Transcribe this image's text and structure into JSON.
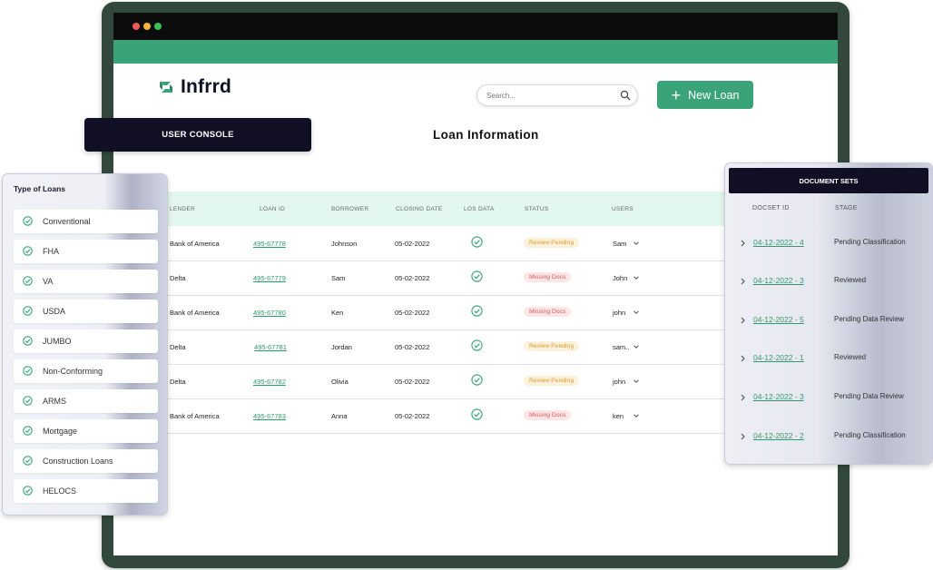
{
  "brand": {
    "name": "Infrrd",
    "accent": "#3aa378",
    "dark": "#100f23"
  },
  "search": {
    "placeholder": "Search..."
  },
  "new_loan_button": {
    "label": "New Loan"
  },
  "user_console": {
    "label": "USER CONSOLE"
  },
  "page_title": "Loan Information",
  "loan_table": {
    "columns": [
      "LENDER",
      "LOAN ID",
      "BORROWER",
      "CLOSING DATE",
      "LOS DATA",
      "STATUS",
      "USERS"
    ],
    "rows": [
      {
        "lender": "Bank of America",
        "loan_id": "495-67778",
        "borrower": "Johnson",
        "closing_date": "05-02-2022",
        "status": "Review Pending",
        "status_kind": "pending",
        "user": "Sam"
      },
      {
        "lender": "Delta",
        "loan_id": "495-67779",
        "borrower": "Sam",
        "closing_date": "05-02-2022",
        "status": "Missing Docs",
        "status_kind": "missing",
        "user": "John"
      },
      {
        "lender": "Bank of America",
        "loan_id": "495-67780",
        "borrower": "Ken",
        "closing_date": "05-02-2022",
        "status": "Missing Docs",
        "status_kind": "missing",
        "user": "john"
      },
      {
        "lender": "Delta",
        "loan_id": "495-67781",
        "borrower": "Jordan",
        "closing_date": "05-02-2022",
        "status": "Review Pending",
        "status_kind": "pending",
        "user": "sam.."
      },
      {
        "lender": "Delta",
        "loan_id": "495-67782",
        "borrower": "Olivia",
        "closing_date": "05-02-2022",
        "status": "Review Pending",
        "status_kind": "pending",
        "user": "john"
      },
      {
        "lender": "Bank of America",
        "loan_id": "495-67783",
        "borrower": "Anna",
        "closing_date": "05-02-2022",
        "status": "Missing Docs",
        "status_kind": "missing",
        "user": "ken"
      }
    ]
  },
  "loan_types": {
    "title": "Type of Loans",
    "items": [
      "Conventional",
      "FHA",
      "VA",
      "USDA",
      "JUMBO",
      "Non-Conforming",
      "ARMS",
      "Mortgage",
      "Construction Loans",
      "HELOCS"
    ]
  },
  "document_sets": {
    "title": "DOCUMENT SETS",
    "columns": [
      "DOCSET ID",
      "STAGE"
    ],
    "rows": [
      {
        "id": "04-12-2022 - 4",
        "stage": "Pending Classification"
      },
      {
        "id": "04-12-2022 - 3",
        "stage": "Reviewed"
      },
      {
        "id": "04-12-2022 - 5",
        "stage": "Pending Data Review"
      },
      {
        "id": "04-12-2022 - 1",
        "stage": "Reviewed"
      },
      {
        "id": "04-12-2022 - 3",
        "stage": "Pending Data Review"
      },
      {
        "id": "04-12-2022 - 2",
        "stage": "Pending Classification"
      }
    ]
  },
  "icons": {
    "check": "check-circle-icon",
    "chevron_down": "chevron-down-icon",
    "chevron_right": "chevron-right-icon",
    "search": "search-icon",
    "plus": "plus-icon"
  }
}
